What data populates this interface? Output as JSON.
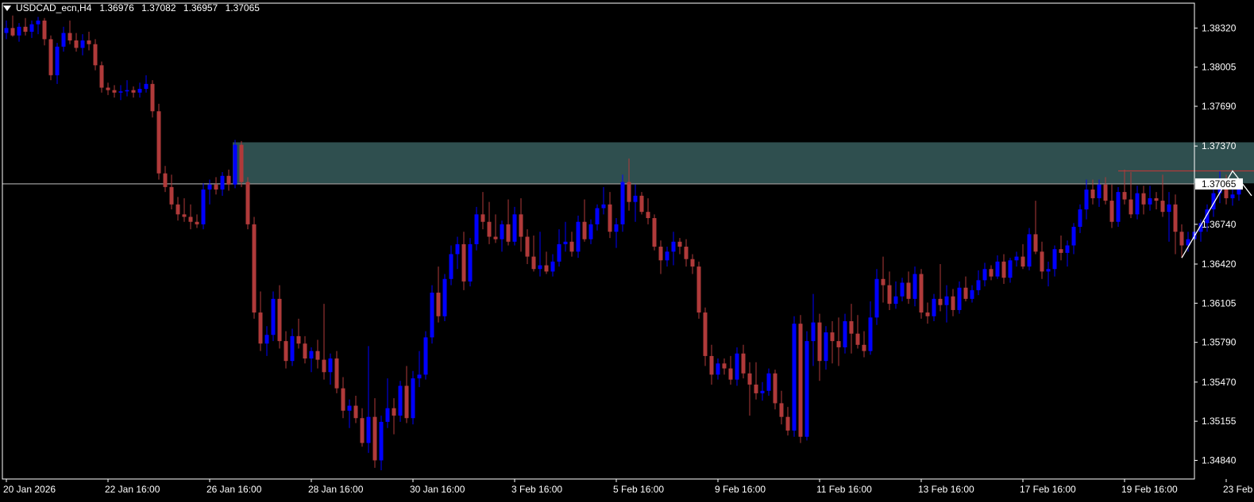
{
  "header": {
    "symbol": "USDCAD_ecn,H4",
    "open": "1.36976",
    "high": "1.37082",
    "low": "1.36957",
    "close": "1.37065"
  },
  "colors": {
    "background": "#000000",
    "bull": "#0000ff",
    "bear": "#b03a3a",
    "wick": "#c0c0c0",
    "zone": "#2f4f4f",
    "axis": "#ffffff",
    "price_line": "#c0c0c0",
    "resistance": "#b03a3a",
    "zigzag": "#ffffff",
    "price_tag_bg": "#ffffff",
    "price_tag_text": "#000000"
  },
  "chart_data": {
    "type": "candlestick",
    "timeframe": "H4",
    "ylim": [
      1.3469,
      1.3852
    ],
    "y_ticks": [
      "1.38320",
      "1.38005",
      "1.37690",
      "1.37370",
      "1.37065",
      "1.36740",
      "1.36420",
      "1.36105",
      "1.35790",
      "1.35470",
      "1.35155",
      "1.34840"
    ],
    "x_tick_labels": [
      "20 Jan 2026",
      "22 Jan 16:00",
      "26 Jan 16:00",
      "28 Jan 16:00",
      "30 Jan 16:00",
      "3 Feb 16:00",
      "5 Feb 16:00",
      "9 Feb 16:00",
      "11 Feb 16:00",
      "13 Feb 16:00",
      "17 Feb 16:00",
      "19 Feb 16:00",
      "23 Feb 16:00"
    ],
    "x_tick_index": [
      0,
      16,
      32,
      48,
      64,
      80,
      96,
      112,
      128,
      144,
      160,
      176,
      192
    ],
    "bar_spacing_label": "H4",
    "current_price": 1.37065,
    "current_price_label": "1.37065",
    "supply_zone": {
      "top": 1.374,
      "bottom": 1.3707,
      "start_index": 36,
      "end_index": 215
    },
    "resistance_line": {
      "price": 1.3717,
      "start_index": 175,
      "end_index": 203
    },
    "zigzag": [
      {
        "index": 185,
        "price": 1.3647
      },
      {
        "index": 193,
        "price": 1.3717
      },
      {
        "index": 196,
        "price": 1.3697
      }
    ],
    "ohlc": [
      [
        1.3828,
        1.3838,
        1.3823,
        1.3832
      ],
      [
        1.3832,
        1.3842,
        1.3825,
        1.3826
      ],
      [
        1.3826,
        1.3836,
        1.3821,
        1.3833
      ],
      [
        1.3833,
        1.384,
        1.3826,
        1.3829
      ],
      [
        1.3829,
        1.3838,
        1.3824,
        1.3835
      ],
      [
        1.3835,
        1.3841,
        1.3827,
        1.3838
      ],
      [
        1.3838,
        1.384,
        1.3818,
        1.3823
      ],
      [
        1.3823,
        1.3826,
        1.379,
        1.3794
      ],
      [
        1.3794,
        1.382,
        1.3787,
        1.3817
      ],
      [
        1.3817,
        1.3833,
        1.3813,
        1.3828
      ],
      [
        1.3828,
        1.3838,
        1.3819,
        1.3822
      ],
      [
        1.3822,
        1.3828,
        1.3813,
        1.3816
      ],
      [
        1.3816,
        1.3827,
        1.381,
        1.3822
      ],
      [
        1.3822,
        1.3829,
        1.3814,
        1.3819
      ],
      [
        1.3819,
        1.3823,
        1.3798,
        1.3802
      ],
      [
        1.3802,
        1.3805,
        1.378,
        1.3784
      ],
      [
        1.3784,
        1.3788,
        1.3778,
        1.3782
      ],
      [
        1.3782,
        1.3786,
        1.3776,
        1.378
      ],
      [
        1.378,
        1.3786,
        1.3774,
        1.3781
      ],
      [
        1.3781,
        1.379,
        1.3777,
        1.3782
      ],
      [
        1.3782,
        1.3785,
        1.3776,
        1.378
      ],
      [
        1.378,
        1.3788,
        1.3776,
        1.3783
      ],
      [
        1.3783,
        1.3794,
        1.378,
        1.3787
      ],
      [
        1.3787,
        1.379,
        1.376,
        1.3765
      ],
      [
        1.3765,
        1.3771,
        1.371,
        1.3715
      ],
      [
        1.3715,
        1.3721,
        1.37,
        1.3704
      ],
      [
        1.3704,
        1.3714,
        1.3686,
        1.369
      ],
      [
        1.369,
        1.3696,
        1.3677,
        1.3682
      ],
      [
        1.3682,
        1.3695,
        1.3676,
        1.368
      ],
      [
        1.368,
        1.369,
        1.367,
        1.3676
      ],
      [
        1.3676,
        1.3682,
        1.3671,
        1.3674
      ],
      [
        1.3674,
        1.3707,
        1.367,
        1.3702
      ],
      [
        1.3702,
        1.371,
        1.369,
        1.3706
      ],
      [
        1.3706,
        1.3712,
        1.3698,
        1.3702
      ],
      [
        1.3702,
        1.3716,
        1.3697,
        1.3713
      ],
      [
        1.3713,
        1.3718,
        1.3701,
        1.3706
      ],
      [
        1.3706,
        1.3742,
        1.3703,
        1.3738
      ],
      [
        1.3738,
        1.3741,
        1.3704,
        1.3708
      ],
      [
        1.3708,
        1.3712,
        1.367,
        1.3674
      ],
      [
        1.3674,
        1.368,
        1.3598,
        1.3603
      ],
      [
        1.3603,
        1.362,
        1.3572,
        1.3578
      ],
      [
        1.3578,
        1.3592,
        1.3568,
        1.3585
      ],
      [
        1.3585,
        1.362,
        1.358,
        1.3614
      ],
      [
        1.3614,
        1.3625,
        1.3574,
        1.358
      ],
      [
        1.358,
        1.3588,
        1.3558,
        1.3564
      ],
      [
        1.3564,
        1.359,
        1.356,
        1.3584
      ],
      [
        1.3584,
        1.3598,
        1.3574,
        1.3578
      ],
      [
        1.3578,
        1.3584,
        1.3562,
        1.3566
      ],
      [
        1.3566,
        1.3575,
        1.3555,
        1.3572
      ],
      [
        1.3572,
        1.3581,
        1.3558,
        1.3565
      ],
      [
        1.3565,
        1.361,
        1.3549,
        1.3555
      ],
      [
        1.3555,
        1.357,
        1.3545,
        1.3566
      ],
      [
        1.3566,
        1.3572,
        1.3538,
        1.3542
      ],
      [
        1.3542,
        1.3551,
        1.3518,
        1.3524
      ],
      [
        1.3524,
        1.3533,
        1.351,
        1.3528
      ],
      [
        1.3528,
        1.3536,
        1.3514,
        1.3518
      ],
      [
        1.3518,
        1.3526,
        1.3495,
        1.3498
      ],
      [
        1.3498,
        1.3576,
        1.349,
        1.3519
      ],
      [
        1.3519,
        1.3534,
        1.3478,
        1.3484
      ],
      [
        1.3484,
        1.352,
        1.3476,
        1.3515
      ],
      [
        1.3515,
        1.355,
        1.351,
        1.3526
      ],
      [
        1.3526,
        1.3534,
        1.3505,
        1.352
      ],
      [
        1.352,
        1.3548,
        1.3515,
        1.3544
      ],
      [
        1.3544,
        1.356,
        1.3514,
        1.3518
      ],
      [
        1.3518,
        1.3556,
        1.3513,
        1.355
      ],
      [
        1.355,
        1.3572,
        1.3543,
        1.3553
      ],
      [
        1.3553,
        1.3588,
        1.3549,
        1.3583
      ],
      [
        1.3583,
        1.3625,
        1.3578,
        1.3619
      ],
      [
        1.3619,
        1.364,
        1.3595,
        1.36
      ],
      [
        1.36,
        1.3634,
        1.3596,
        1.363
      ],
      [
        1.363,
        1.3657,
        1.3625,
        1.365
      ],
      [
        1.365,
        1.3664,
        1.3638,
        1.3658
      ],
      [
        1.3658,
        1.3668,
        1.3621,
        1.3628
      ],
      [
        1.3628,
        1.3663,
        1.3624,
        1.3658
      ],
      [
        1.3658,
        1.3688,
        1.3653,
        1.3682
      ],
      [
        1.3682,
        1.37,
        1.367,
        1.3676
      ],
      [
        1.3676,
        1.3692,
        1.3658,
        1.3664
      ],
      [
        1.3664,
        1.3682,
        1.3659,
        1.3662
      ],
      [
        1.3662,
        1.3677,
        1.3652,
        1.3674
      ],
      [
        1.3674,
        1.3694,
        1.3657,
        1.366
      ],
      [
        1.366,
        1.3688,
        1.3657,
        1.3682
      ],
      [
        1.3682,
        1.3695,
        1.3652,
        1.3664
      ],
      [
        1.3664,
        1.367,
        1.3642,
        1.3648
      ],
      [
        1.3648,
        1.3665,
        1.3636,
        1.3638
      ],
      [
        1.3638,
        1.3668,
        1.3632,
        1.3641
      ],
      [
        1.3641,
        1.3652,
        1.3634,
        1.3636
      ],
      [
        1.3636,
        1.365,
        1.3632,
        1.3644
      ],
      [
        1.3644,
        1.367,
        1.364,
        1.3658
      ],
      [
        1.3658,
        1.3676,
        1.3652,
        1.366
      ],
      [
        1.366,
        1.3668,
        1.3648,
        1.3652
      ],
      [
        1.3652,
        1.3681,
        1.3647,
        1.3676
      ],
      [
        1.3676,
        1.3694,
        1.366,
        1.3662
      ],
      [
        1.3662,
        1.3678,
        1.3658,
        1.3674
      ],
      [
        1.3674,
        1.369,
        1.3669,
        1.3687
      ],
      [
        1.3687,
        1.3704,
        1.3682,
        1.369
      ],
      [
        1.369,
        1.37,
        1.3663,
        1.3668
      ],
      [
        1.3668,
        1.3679,
        1.3655,
        1.3674
      ],
      [
        1.3674,
        1.3714,
        1.3668,
        1.3708
      ],
      [
        1.3708,
        1.3727,
        1.3685,
        1.3692
      ],
      [
        1.3692,
        1.3706,
        1.3676,
        1.3697
      ],
      [
        1.3697,
        1.37,
        1.3682,
        1.3684
      ],
      [
        1.3684,
        1.3695,
        1.3674,
        1.3679
      ],
      [
        1.3679,
        1.3682,
        1.3653,
        1.3656
      ],
      [
        1.3656,
        1.3661,
        1.3634,
        1.3645
      ],
      [
        1.3645,
        1.3656,
        1.364,
        1.3652
      ],
      [
        1.3652,
        1.3668,
        1.3641,
        1.366
      ],
      [
        1.366,
        1.3663,
        1.365,
        1.3656
      ],
      [
        1.3656,
        1.3662,
        1.364,
        1.3646
      ],
      [
        1.3646,
        1.365,
        1.3634,
        1.364
      ],
      [
        1.364,
        1.3644,
        1.3598,
        1.3603
      ],
      [
        1.3603,
        1.3607,
        1.356,
        1.3568
      ],
      [
        1.3568,
        1.3577,
        1.3545,
        1.3553
      ],
      [
        1.3553,
        1.3566,
        1.3549,
        1.3562
      ],
      [
        1.3562,
        1.3566,
        1.3553,
        1.3558
      ],
      [
        1.3558,
        1.3568,
        1.3545,
        1.3549
      ],
      [
        1.3549,
        1.3575,
        1.3544,
        1.357
      ],
      [
        1.357,
        1.3577,
        1.355,
        1.3554
      ],
      [
        1.3554,
        1.3563,
        1.352,
        1.3545
      ],
      [
        1.3545,
        1.3563,
        1.3533,
        1.3538
      ],
      [
        1.3538,
        1.3547,
        1.3532,
        1.354
      ],
      [
        1.354,
        1.3558,
        1.3536,
        1.3554
      ],
      [
        1.3554,
        1.3557,
        1.3525,
        1.353
      ],
      [
        1.353,
        1.354,
        1.3513,
        1.3519
      ],
      [
        1.3519,
        1.3527,
        1.3504,
        1.3508
      ],
      [
        1.3508,
        1.36,
        1.3503,
        1.3594
      ],
      [
        1.3594,
        1.3601,
        1.3498,
        1.3503
      ],
      [
        1.3503,
        1.3588,
        1.35,
        1.358
      ],
      [
        1.358,
        1.3618,
        1.356,
        1.3595
      ],
      [
        1.3595,
        1.3602,
        1.3548,
        1.3564
      ],
      [
        1.3564,
        1.3592,
        1.3557,
        1.3587
      ],
      [
        1.3587,
        1.3596,
        1.3562,
        1.358
      ],
      [
        1.358,
        1.3599,
        1.356,
        1.3575
      ],
      [
        1.3575,
        1.3602,
        1.357,
        1.3596
      ],
      [
        1.3596,
        1.361,
        1.357,
        1.3586
      ],
      [
        1.3586,
        1.3601,
        1.3574,
        1.3577
      ],
      [
        1.3577,
        1.3588,
        1.3567,
        1.3572
      ],
      [
        1.3572,
        1.3612,
        1.3569,
        1.3599
      ],
      [
        1.3599,
        1.3638,
        1.3593,
        1.363
      ],
      [
        1.363,
        1.3648,
        1.3611,
        1.3625
      ],
      [
        1.3625,
        1.3636,
        1.3605,
        1.361
      ],
      [
        1.361,
        1.3628,
        1.3606,
        1.3616
      ],
      [
        1.3616,
        1.3631,
        1.3612,
        1.3627
      ],
      [
        1.3627,
        1.3636,
        1.361,
        1.3614
      ],
      [
        1.3614,
        1.364,
        1.3608,
        1.3634
      ],
      [
        1.3634,
        1.3638,
        1.3598,
        1.3603
      ],
      [
        1.3603,
        1.3611,
        1.3594,
        1.36
      ],
      [
        1.36,
        1.3618,
        1.3596,
        1.3614
      ],
      [
        1.3614,
        1.3642,
        1.3604,
        1.3609
      ],
      [
        1.3609,
        1.3625,
        1.3595,
        1.3616
      ],
      [
        1.3616,
        1.3622,
        1.36,
        1.3605
      ],
      [
        1.3605,
        1.3628,
        1.3602,
        1.3623
      ],
      [
        1.3623,
        1.3632,
        1.3612,
        1.3614
      ],
      [
        1.3614,
        1.3625,
        1.3611,
        1.3621
      ],
      [
        1.3621,
        1.3637,
        1.3617,
        1.3629
      ],
      [
        1.3629,
        1.3643,
        1.3624,
        1.3638
      ],
      [
        1.3638,
        1.3641,
        1.3629,
        1.3632
      ],
      [
        1.3632,
        1.3649,
        1.363,
        1.3644
      ],
      [
        1.3644,
        1.365,
        1.3626,
        1.3631
      ],
      [
        1.3631,
        1.3647,
        1.3627,
        1.3645
      ],
      [
        1.3645,
        1.3652,
        1.364,
        1.3648
      ],
      [
        1.3648,
        1.3658,
        1.3638,
        1.364
      ],
      [
        1.364,
        1.3671,
        1.3637,
        1.3666
      ],
      [
        1.3666,
        1.3693,
        1.365,
        1.3652
      ],
      [
        1.3652,
        1.366,
        1.363,
        1.3636
      ],
      [
        1.3636,
        1.3644,
        1.3624,
        1.3638
      ],
      [
        1.3638,
        1.3657,
        1.3632,
        1.3654
      ],
      [
        1.3654,
        1.3665,
        1.3645,
        1.3651
      ],
      [
        1.3651,
        1.3661,
        1.364,
        1.3657
      ],
      [
        1.3657,
        1.3675,
        1.365,
        1.3672
      ],
      [
        1.3672,
        1.369,
        1.3667,
        1.3686
      ],
      [
        1.3686,
        1.371,
        1.3678,
        1.3702
      ],
      [
        1.3702,
        1.371,
        1.369,
        1.3695
      ],
      [
        1.3695,
        1.371,
        1.3688,
        1.3706
      ],
      [
        1.3706,
        1.3712,
        1.369,
        1.3693
      ],
      [
        1.3693,
        1.3706,
        1.3671,
        1.3676
      ],
      [
        1.3676,
        1.3704,
        1.3672,
        1.37
      ],
      [
        1.37,
        1.3718,
        1.369,
        1.3694
      ],
      [
        1.3694,
        1.3716,
        1.3679,
        1.3682
      ],
      [
        1.3682,
        1.3705,
        1.3678,
        1.3699
      ],
      [
        1.3699,
        1.3705,
        1.3682,
        1.369
      ],
      [
        1.369,
        1.3705,
        1.3685,
        1.3695
      ],
      [
        1.3695,
        1.37,
        1.3686,
        1.3693
      ],
      [
        1.3693,
        1.3714,
        1.368,
        1.3684
      ],
      [
        1.3684,
        1.37,
        1.366,
        1.369
      ],
      [
        1.369,
        1.3698,
        1.365,
        1.3668
      ],
      [
        1.3668,
        1.3674,
        1.3647,
        1.3657
      ],
      [
        1.3657,
        1.3668,
        1.3652,
        1.3662
      ],
      [
        1.3662,
        1.3672,
        1.3656,
        1.3668
      ],
      [
        1.3668,
        1.3678,
        1.366,
        1.3675
      ],
      [
        1.3675,
        1.369,
        1.3668,
        1.3686
      ],
      [
        1.3686,
        1.3703,
        1.368,
        1.3699
      ],
      [
        1.3699,
        1.3717,
        1.3691,
        1.3705
      ],
      [
        1.3705,
        1.3714,
        1.369,
        1.3695
      ],
      [
        1.3695,
        1.3708,
        1.3689,
        1.3698
      ],
      [
        1.3698,
        1.371,
        1.3693,
        1.3706
      ]
    ]
  }
}
